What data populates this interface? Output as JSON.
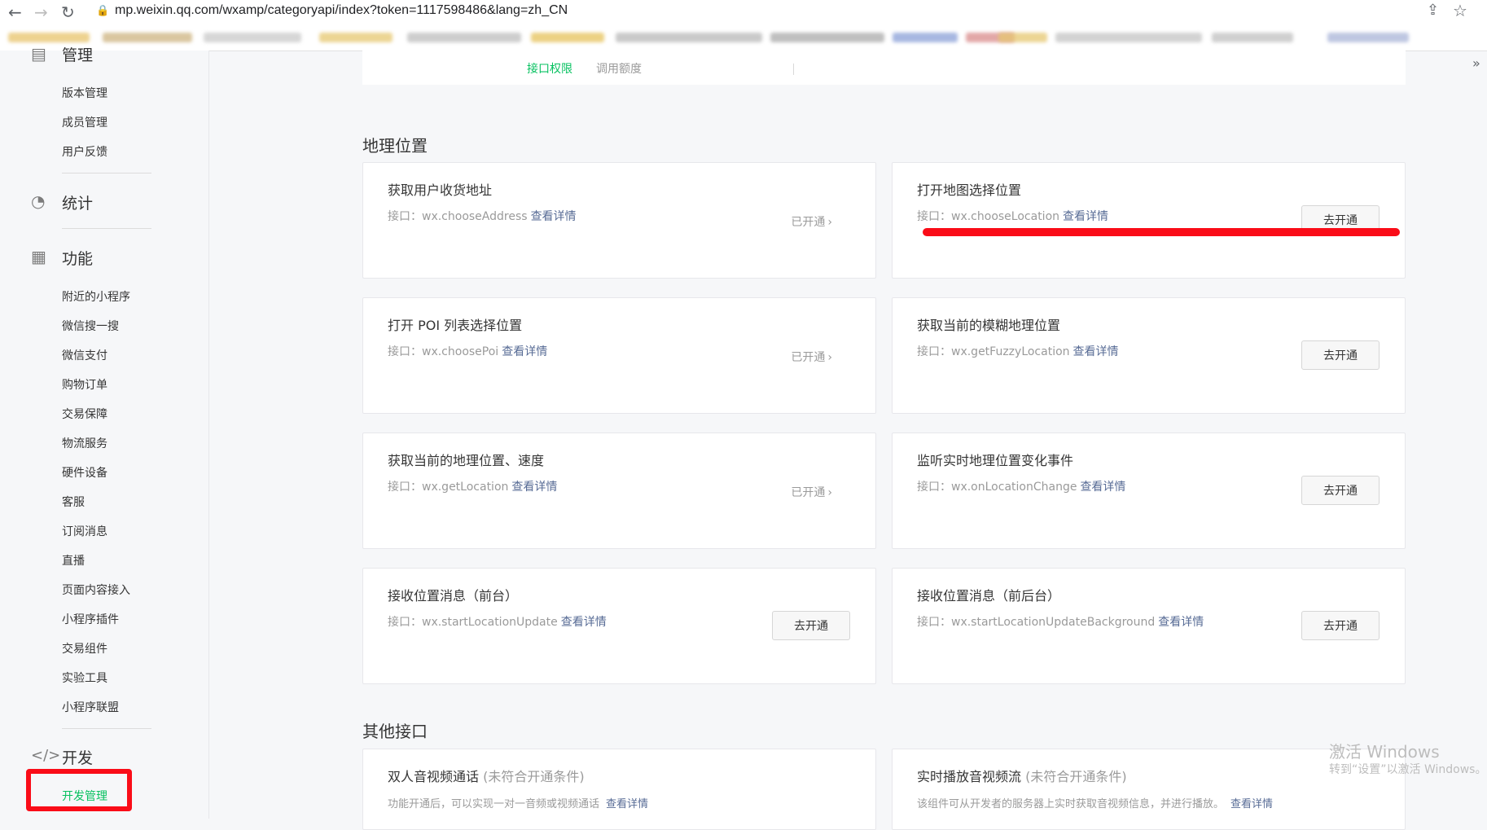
{
  "browser": {
    "url": "mp.weixin.qq.com/wxamp/categoryapi/index?token=1117598486&lang=zh_CN"
  },
  "sidebar": {
    "top_partial_label": "管理",
    "manage_items": [
      {
        "label": "版本管理"
      },
      {
        "label": "成员管理"
      },
      {
        "label": "用户反馈"
      }
    ],
    "stats_label": "统计",
    "features_label": "功能",
    "feature_items": [
      {
        "label": "附近的小程序"
      },
      {
        "label": "微信搜一搜"
      },
      {
        "label": "微信支付"
      },
      {
        "label": "购物订单"
      },
      {
        "label": "交易保障"
      },
      {
        "label": "物流服务"
      },
      {
        "label": "硬件设备"
      },
      {
        "label": "客服"
      },
      {
        "label": "订阅消息"
      },
      {
        "label": "直播"
      },
      {
        "label": "页面内容接入"
      },
      {
        "label": "小程序插件"
      },
      {
        "label": "交易组件"
      },
      {
        "label": "实验工具"
      },
      {
        "label": "小程序联盟"
      }
    ],
    "dev_label": "开发",
    "dev_items": [
      {
        "label": "开发管理"
      }
    ]
  },
  "tabs": {
    "items": [
      {
        "label": "接口权限"
      },
      {
        "label": "调用额度"
      }
    ]
  },
  "sections": {
    "location_title": "地理位置",
    "other_title": "其他接口"
  },
  "common": {
    "api_prefix": "接口：",
    "detail_link": "查看详情",
    "enabled_status": "已开通",
    "enable_button": "去开通"
  },
  "location_cards": [
    {
      "title": "获取用户收货地址",
      "api": "wx.chooseAddress"
    },
    {
      "title": "打开地图选择位置",
      "api": "wx.chooseLocation"
    },
    {
      "title": "打开 POI 列表选择位置",
      "api": "wx.choosePoi"
    },
    {
      "title": "获取当前的模糊地理位置",
      "api": "wx.getFuzzyLocation"
    },
    {
      "title": "获取当前的地理位置、速度",
      "api": "wx.getLocation"
    },
    {
      "title": "监听实时地理位置变化事件",
      "api": "wx.onLocationChange"
    },
    {
      "title": "接收位置消息（前台）",
      "api": "wx.startLocationUpdate"
    },
    {
      "title": "接收位置消息（前后台）",
      "api": "wx.startLocationUpdateBackground"
    }
  ],
  "other_cards": [
    {
      "title": "双人音视频通话",
      "note": "(未符合开通条件)",
      "desc": "功能开通后，可以实现一对一音频或视频通话"
    },
    {
      "title": "实时播放音视频流",
      "note": "(未符合开通条件)",
      "desc": "该组件可从开发者的服务器上实时获取音视频信息，并进行播放。"
    }
  ],
  "watermark": {
    "line1": "激活 Windows",
    "line2": "转到“设置”以激活 Windows。"
  },
  "colors": {
    "accent_green": "#07c160",
    "link_blue": "#576b95",
    "annotation_red": "#fa0c18"
  }
}
